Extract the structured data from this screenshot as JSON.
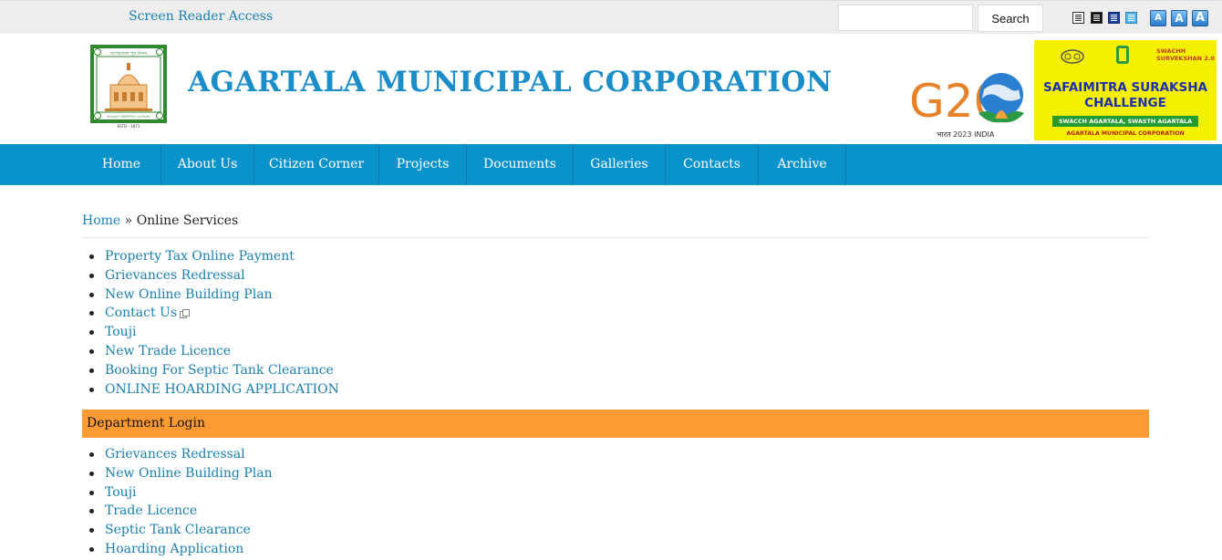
{
  "topbar": {
    "screen_reader_link": "Screen Reader Access",
    "search_placeholder": "",
    "search_button": "Search",
    "font_size_labels": [
      "A",
      "A",
      "A"
    ]
  },
  "header": {
    "site_title": "AGARTALA MUNICIPAL CORPORATION",
    "logo_texts": [
      "আগরতলা পুর নিগম",
      "আগরতলা মিউনিসিপ্যাল কর্পোরেশন",
      "ESTD - 1871"
    ],
    "g20_text": "G20",
    "g20_subtitle": "भारत 2023 INDIA",
    "banner": {
      "title_line1": "SAFAIMITRA SURAKSHA",
      "title_line2": "CHALLENGE",
      "tagline": "SWACCH AGARTALA, SWASTH AGARTALA",
      "footer": "AGARTALA MUNICIPAL CORPORATION",
      "side_text": "SWACHH SURVEKSHAN 2.0"
    }
  },
  "nav": {
    "items": [
      {
        "label": "Home"
      },
      {
        "label": "About Us"
      },
      {
        "label": "Citizen Corner"
      },
      {
        "label": "Projects"
      },
      {
        "label": "Documents"
      },
      {
        "label": "Galleries"
      },
      {
        "label": "Contacts"
      },
      {
        "label": "Archive"
      }
    ]
  },
  "breadcrumb": {
    "home": "Home",
    "separator": "»",
    "current": "Online Services"
  },
  "online_services": [
    "Property Tax Online Payment",
    "Grievances Redressal",
    "New Online Building Plan",
    "Contact Us",
    "Touji",
    "New Trade Licence",
    "Booking For Septic Tank Clearance",
    "ONLINE HOARDING APPLICATION"
  ],
  "department_login": {
    "heading": "Department Login",
    "items": [
      "Grievances Redressal",
      "New Online Building Plan",
      "Touji",
      "Trade Licence",
      "Septic Tank Clearance",
      "Hoarding Application"
    ]
  },
  "colors": {
    "nav_bg": "#0a93cb",
    "title": "#1b8dc8",
    "link": "#1a7fb0",
    "dept_heading_bg": "#fe9a33",
    "topbar_bg": "#ededed",
    "banner_bg": "#f4f000"
  }
}
